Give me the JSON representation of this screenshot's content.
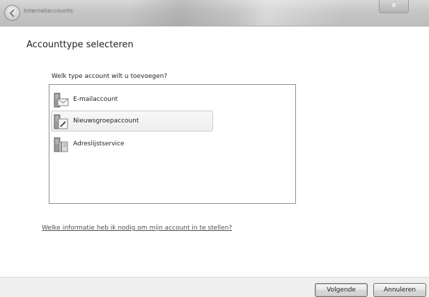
{
  "window": {
    "title": "Internetaccounts"
  },
  "titlebar": {
    "back_icon": "back-arrow-icon",
    "close_label": "x"
  },
  "main": {
    "page_title": "Accounttype selecteren",
    "question": "Welk type account wilt u toevoegen?",
    "account_types": [
      {
        "label": "E-mailaccount",
        "icon": "email-account-icon",
        "highlighted": false
      },
      {
        "label": "Nieuwsgroepaccount",
        "icon": "newsgroup-account-icon",
        "highlighted": true
      },
      {
        "label": "Adreslijstservice",
        "icon": "directory-service-icon",
        "highlighted": false
      }
    ],
    "help_link": "Welke informatie heb ik nodig om mijn account in te stellen?"
  },
  "footer": {
    "next_label": "Volgende",
    "cancel_label": "Annuleren"
  }
}
